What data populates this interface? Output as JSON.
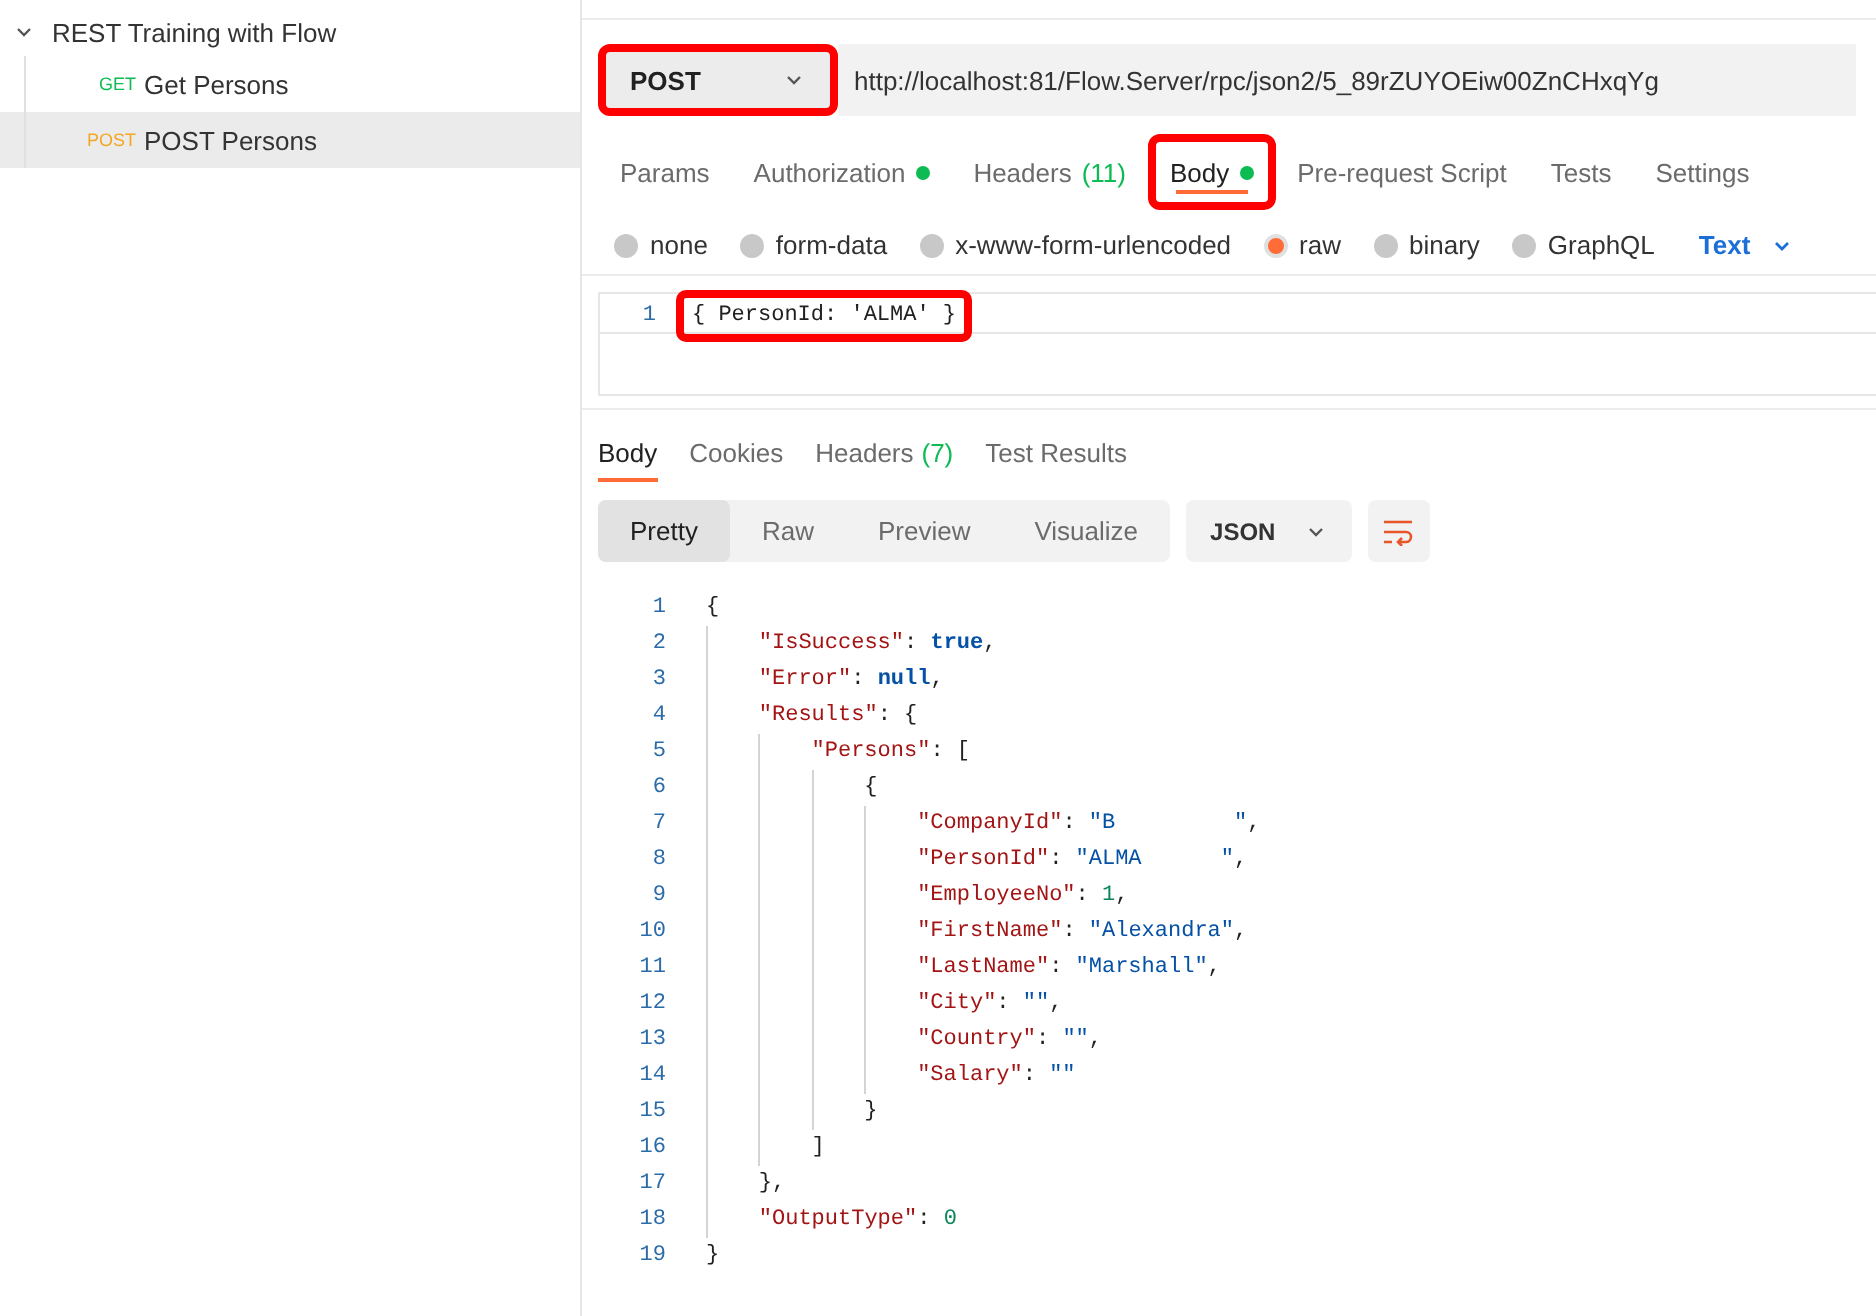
{
  "sidebar": {
    "collection": {
      "name": "REST Training with Flow",
      "expanded": true,
      "children": [
        {
          "method": "GET",
          "name": "Get Persons",
          "selected": false
        },
        {
          "method": "POST",
          "name": "POST Persons",
          "selected": true
        }
      ]
    }
  },
  "request": {
    "method": "POST",
    "method_highlighted": true,
    "url": "http://localhost:81/Flow.Server/rpc/json2/5_89rZUYOEiw00ZnCHxqYg",
    "tabs": [
      {
        "label": "Params",
        "selected": false,
        "dot": false,
        "highlighted": false
      },
      {
        "label": "Authorization",
        "selected": false,
        "dot": true,
        "highlighted": false
      },
      {
        "label": "Headers",
        "count": "(11)",
        "selected": false,
        "dot": false,
        "highlighted": false
      },
      {
        "label": "Body",
        "selected": true,
        "dot": true,
        "highlighted": true
      },
      {
        "label": "Pre-request Script",
        "selected": false,
        "dot": false,
        "highlighted": false
      },
      {
        "label": "Tests",
        "selected": false,
        "dot": false,
        "highlighted": false
      },
      {
        "label": "Settings",
        "selected": false,
        "dot": false,
        "highlighted": false
      }
    ],
    "body_types": [
      {
        "label": "none",
        "selected": false
      },
      {
        "label": "form-data",
        "selected": false
      },
      {
        "label": "x-www-form-urlencoded",
        "selected": false
      },
      {
        "label": "raw",
        "selected": true
      },
      {
        "label": "binary",
        "selected": false
      },
      {
        "label": "GraphQL",
        "selected": false
      }
    ],
    "language": "Text",
    "editor": [
      {
        "number": "1",
        "text": "{ PersonId: 'ALMA' }",
        "highlighted": true
      }
    ]
  },
  "response": {
    "tabs": [
      {
        "label": "Body",
        "selected": true
      },
      {
        "label": "Cookies",
        "selected": false
      },
      {
        "label": "Headers",
        "count": "(7)",
        "selected": false
      },
      {
        "label": "Test Results",
        "selected": false
      }
    ],
    "views": [
      {
        "label": "Pretty",
        "selected": true
      },
      {
        "label": "Raw",
        "selected": false
      },
      {
        "label": "Preview",
        "selected": false
      },
      {
        "label": "Visualize",
        "selected": false
      }
    ],
    "format": "JSON",
    "lines": [
      {
        "number": "1",
        "tokens": [
          {
            "kind": "punct",
            "text": "{"
          }
        ]
      },
      {
        "number": "2",
        "tokens": [
          {
            "kind": "key",
            "text": "\"IsSuccess\""
          },
          {
            "kind": "punct",
            "text": ": "
          },
          {
            "kind": "keyword",
            "text": "true"
          },
          {
            "kind": "punct",
            "text": ","
          }
        ]
      },
      {
        "number": "3",
        "tokens": [
          {
            "kind": "key",
            "text": "\"Error\""
          },
          {
            "kind": "punct",
            "text": ": "
          },
          {
            "kind": "keyword",
            "text": "null"
          },
          {
            "kind": "punct",
            "text": ","
          }
        ]
      },
      {
        "number": "4",
        "tokens": [
          {
            "kind": "key",
            "text": "\"Results\""
          },
          {
            "kind": "punct",
            "text": ": {"
          }
        ]
      },
      {
        "number": "5",
        "tokens": [
          {
            "kind": "key",
            "text": "\"Persons\""
          },
          {
            "kind": "punct",
            "text": ": ["
          }
        ]
      },
      {
        "number": "6",
        "tokens": [
          {
            "kind": "punct",
            "text": "{"
          }
        ]
      },
      {
        "number": "7",
        "tokens": [
          {
            "kind": "key",
            "text": "\"CompanyId\""
          },
          {
            "kind": "punct",
            "text": ": "
          },
          {
            "kind": "string",
            "text": "\"B         \""
          },
          {
            "kind": "punct",
            "text": ","
          }
        ]
      },
      {
        "number": "8",
        "tokens": [
          {
            "kind": "key",
            "text": "\"PersonId\""
          },
          {
            "kind": "punct",
            "text": ": "
          },
          {
            "kind": "string",
            "text": "\"ALMA      \""
          },
          {
            "kind": "punct",
            "text": ","
          }
        ]
      },
      {
        "number": "9",
        "tokens": [
          {
            "kind": "key",
            "text": "\"EmployeeNo\""
          },
          {
            "kind": "punct",
            "text": ": "
          },
          {
            "kind": "number",
            "text": "1"
          },
          {
            "kind": "punct",
            "text": ","
          }
        ]
      },
      {
        "number": "10",
        "tokens": [
          {
            "kind": "key",
            "text": "\"FirstName\""
          },
          {
            "kind": "punct",
            "text": ": "
          },
          {
            "kind": "string",
            "text": "\"Alexandra\""
          },
          {
            "kind": "punct",
            "text": ","
          }
        ]
      },
      {
        "number": "11",
        "tokens": [
          {
            "kind": "key",
            "text": "\"LastName\""
          },
          {
            "kind": "punct",
            "text": ": "
          },
          {
            "kind": "string",
            "text": "\"Marshall\""
          },
          {
            "kind": "punct",
            "text": ","
          }
        ]
      },
      {
        "number": "12",
        "tokens": [
          {
            "kind": "key",
            "text": "\"City\""
          },
          {
            "kind": "punct",
            "text": ": "
          },
          {
            "kind": "string",
            "text": "\"\""
          },
          {
            "kind": "punct",
            "text": ","
          }
        ]
      },
      {
        "number": "13",
        "tokens": [
          {
            "kind": "key",
            "text": "\"Country\""
          },
          {
            "kind": "punct",
            "text": ": "
          },
          {
            "kind": "string",
            "text": "\"\""
          },
          {
            "kind": "punct",
            "text": ","
          }
        ]
      },
      {
        "number": "14",
        "tokens": [
          {
            "kind": "key",
            "text": "\"Salary\""
          },
          {
            "kind": "punct",
            "text": ": "
          },
          {
            "kind": "string",
            "text": "\"\""
          }
        ]
      },
      {
        "number": "15",
        "tokens": [
          {
            "kind": "punct",
            "text": "}"
          }
        ]
      },
      {
        "number": "16",
        "tokens": [
          {
            "kind": "punct",
            "text": "]"
          }
        ]
      },
      {
        "number": "17",
        "tokens": [
          {
            "kind": "punct",
            "text": "},"
          }
        ]
      },
      {
        "number": "18",
        "tokens": [
          {
            "kind": "key",
            "text": "\"OutputType\""
          },
          {
            "kind": "punct",
            "text": ": "
          },
          {
            "kind": "number",
            "text": "0"
          }
        ]
      },
      {
        "number": "19",
        "tokens": [
          {
            "kind": "punct",
            "text": "}"
          }
        ]
      }
    ]
  }
}
